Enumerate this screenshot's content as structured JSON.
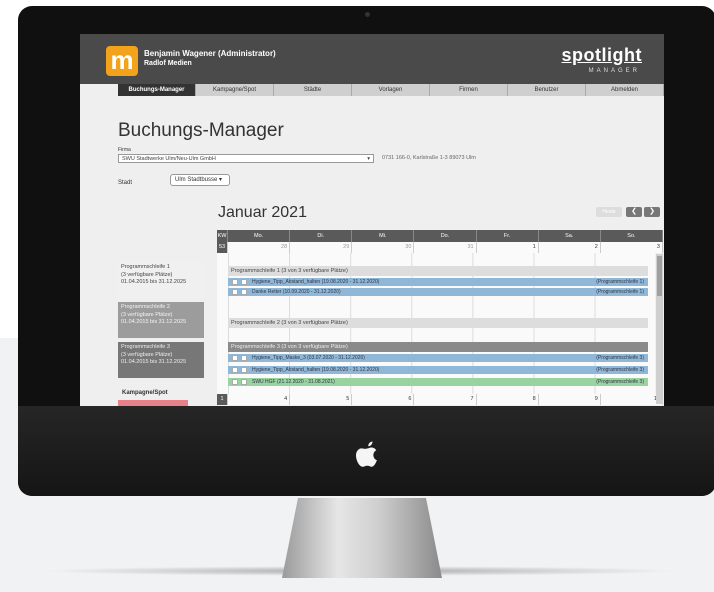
{
  "user": {
    "name": "Benjamin Wagener (Administrator)",
    "company": "Radlof Medien",
    "logo_letter": "m"
  },
  "brand": {
    "name": "spotlight",
    "sub": "MANAGER"
  },
  "nav": [
    "Buchungs-Manager",
    "Kampagne/Spot",
    "Städte",
    "Vorlagen",
    "Firmen",
    "Benutzer",
    "Abmelden"
  ],
  "page": {
    "title": "Buchungs-Manager"
  },
  "filters": {
    "firma_label": "Firma",
    "firma_value": "SWU Stadtwerke Ulm/Neu-Ulm GmbH",
    "firma_address": "0731 166-0, Karlstraße 1-3 89073 Ulm",
    "stadt_label": "Stadt",
    "stadt_value": "Ulm Stadtbusse"
  },
  "calendar": {
    "month": "Januar 2021",
    "controls": {
      "today": "Heute",
      "prev": "❮",
      "next": "❯"
    },
    "headers": [
      "KW",
      "Mo.",
      "Di.",
      "Mi.",
      "Do.",
      "Fr.",
      "Sa.",
      "So."
    ],
    "week1": {
      "kw": "53",
      "days": [
        "28",
        "29",
        "30",
        "31",
        "1",
        "2",
        "3"
      ]
    },
    "week2": {
      "kw": "1",
      "days": [
        "4",
        "5",
        "6",
        "7",
        "8",
        "9",
        "10"
      ]
    },
    "rows": {
      "p1": "Programmschleife 1 (3 von 3 verfügbare Plätze)",
      "b1": "Hygiene_Tipp_Abstand_halten (19.08.2020 - 31.12.2020)",
      "b1_tag": "(Programmschleife 1)",
      "b2": "Danke Retter (10.09.2020 - 31.12.2020)",
      "b2_tag": "(Programmschleife 1)",
      "p2": "Programmschleife 2 (3 von 3 verfügbare Plätze)",
      "p3": "Programmschleife 3 (3 von 3 verfügbare Plätze)",
      "b3": "Hygiene_Tipp_Maske_3 (03.07.2020 - 31.12.2020)",
      "b3_tag": "(Programmschleife 3)",
      "b4": "Hygiene_Tipp_Abstand_halten (19.08.2020 - 31.12.2020)",
      "b4_tag": "(Programmschleife 3)",
      "b5": "SWU HGF (21.12.2020 - 31.08.2021)",
      "b5_tag": "(Programmschleife 3)"
    }
  },
  "programs": [
    {
      "line1": "Programmschleife 1",
      "line2": "(3 verfügbare Plätze)",
      "line3": "01.04.2015 bis 31.12.2025"
    },
    {
      "line1": "Programmschleife 2",
      "line2": "(3 verfügbare Plätze)",
      "line3": "01.04.2015 bis 31.12.2025"
    },
    {
      "line1": "Programmschleife 3",
      "line2": "(3 verfügbare Plätze)",
      "line3": "01.04.2015 bis 31.12.2025"
    }
  ],
  "kampagne": {
    "label": "Kampagne/Spot"
  },
  "colors": {
    "accent_orange": "#f2a31b",
    "booking_blue": "#8fb8d8",
    "booking_green": "#98d3a0",
    "kampagne_red": "#e8828a"
  }
}
